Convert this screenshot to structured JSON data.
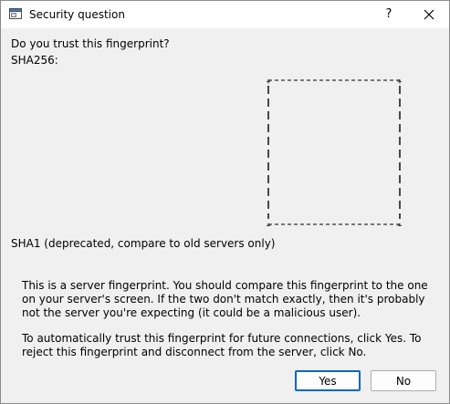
{
  "window": {
    "title": "Security question",
    "help_label": "?",
    "icons": {
      "app": "window-app-icon",
      "close": "close-icon"
    }
  },
  "content": {
    "question": "Do you trust this fingerprint?",
    "sha256_label": "SHA256:",
    "sha1_label": "SHA1 (deprecated, compare to old servers only)",
    "note_paragraph_1": "This is a server fingerprint. You should compare this fingerprint to the one on your server's screen. If the two don't match exactly, then it's probably not the server you're expecting (it could be a malicious user).",
    "note_paragraph_2": "To automatically trust this fingerprint for future connections, click Yes. To reject this fingerprint and disconnect from the server, click No."
  },
  "buttons": {
    "yes": "Yes",
    "no": "No"
  },
  "colors": {
    "background": "#f0f0f0",
    "titlebar": "#ffffff",
    "default_button_border": "#0067c0"
  }
}
